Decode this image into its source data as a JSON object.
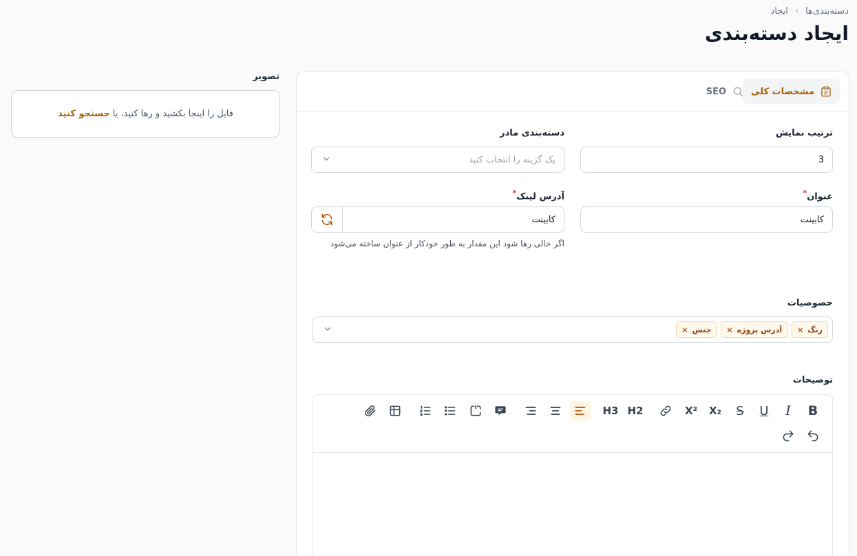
{
  "breadcrumb": {
    "parent": "دسته‌بندی‌ها",
    "current": "ایجاد"
  },
  "page_title": "ایجاد دسته‌بندی",
  "tabs": {
    "general": "مشخصات کلی",
    "seo": "SEO"
  },
  "form": {
    "display_order_label": "ترتیب نمایش",
    "display_order_value": "3",
    "parent_label": "دسته‌بندی مادر",
    "parent_placeholder": "یک گزینه را انتخاب کنید",
    "title_label": "عنوان",
    "title_value": "کابینت",
    "slug_label": "آدرس لینک",
    "slug_value": "کابینت",
    "slug_hint": "اگر خالی رها شود این مقدار به طور خودکار از عنوان ساخته می‌شود",
    "attributes_label": "خصوصیات",
    "attributes": [
      "رنگ",
      "آدرس پروژه",
      "جنس"
    ],
    "description_label": "توضیحات",
    "required_mark": "*"
  },
  "toolbar": {
    "bold": "B",
    "italic": "I",
    "underline": "U",
    "strike": "S",
    "subscript": "X₂",
    "superscript": "X²",
    "h2": "H2",
    "h3": "H3"
  },
  "upload": {
    "label": "تصویر",
    "text": "فایل را اینجا بکشید و رها کنید، یا",
    "link": "جستجو کنید"
  },
  "colors": {
    "accent": "#a16207",
    "chip_bg": "#fef9ec",
    "required": "#dc2626"
  }
}
